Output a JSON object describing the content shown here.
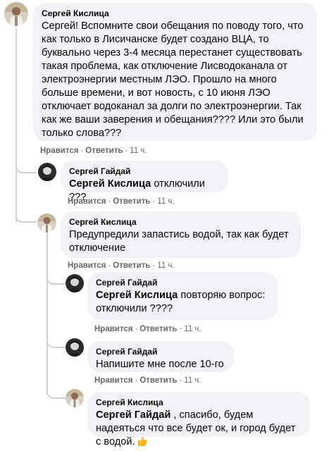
{
  "comments": [
    {
      "author": "Сергей Кислица",
      "text": "Сергей! Вспомните свои обещания по поводу того, что как только в Лисичанске будет создано ВЦА, то буквально через 3-4 месяца перестанет существовать такая проблема, как отключение Лисводоканала от электроэнергии местным ЛЭО. Прошло на много больше времени, и вот новость, с 10 июня ЛЭО отключает водоканал за долги по электроэнергии. Так как же ваши заверения и обещания???? Или это были только слова???",
      "like": "Нравится",
      "reply": "Ответить",
      "time": "11 ч."
    },
    {
      "author": "Сергей Гайдай",
      "mention": "Сергей Кислица",
      "text": " отключили ???",
      "like": "Нравится",
      "reply": "Ответить",
      "time": "11 ч."
    },
    {
      "author": "Сергей Кислица",
      "text": "Предупредили запастись водой, так как будет отключение",
      "like": "Нравится",
      "reply": "Ответить",
      "time": "11 ч."
    },
    {
      "author": "Сергей Гайдай",
      "mention": "Сергей Кислица",
      "text": " повторяю вопрос: отключили ????",
      "like": "Нравится",
      "reply": "Ответить",
      "time": "11 ч."
    },
    {
      "author": "Сергей Гайдай",
      "text": "Напишите мне после 10-го",
      "like": "Нравится",
      "reply": "Ответить",
      "time": "11 ч."
    },
    {
      "author": "Сергей Кислица",
      "mention": "Сергей Гайдай",
      "text": " , спасибо, будем надеяться что все будет ок, и город будет с водой.",
      "emoji": "thumbs-up-emoji"
    }
  ],
  "colors": {
    "bubble": "#f0f2f5",
    "meta": "#65676b",
    "line": "#ced0d4",
    "thumb": "#f7b125"
  }
}
